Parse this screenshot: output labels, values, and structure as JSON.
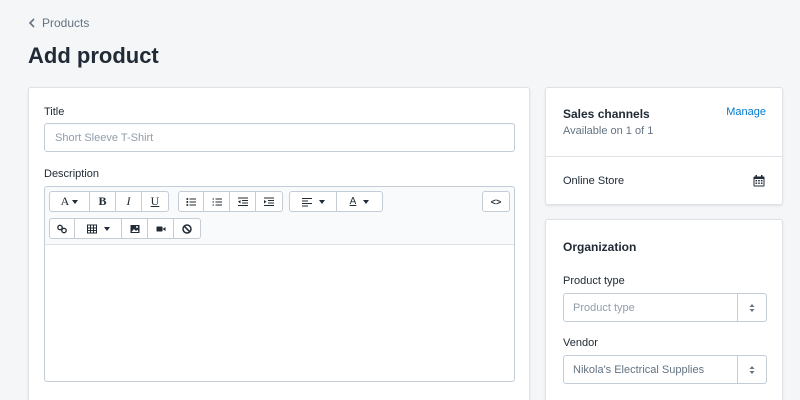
{
  "breadcrumb": {
    "label": "Products"
  },
  "page": {
    "title": "Add product"
  },
  "product": {
    "title_label": "Title",
    "title_placeholder": "Short Sleeve T-Shirt",
    "description_label": "Description",
    "toolbar": {
      "font_label": "A",
      "bold_label": "B",
      "italic_label": "I",
      "underline_label": "U",
      "align_icon": "align-left-icon",
      "color_label": "A",
      "code_label": "<>"
    }
  },
  "sales_channels": {
    "title": "Sales channels",
    "subtitle": "Available on 1 of 1",
    "manage_label": "Manage",
    "channel": "Online Store"
  },
  "organization": {
    "title": "Organization",
    "product_type_label": "Product type",
    "product_type_value": "Product type",
    "vendor_label": "Vendor",
    "vendor_value": "Nikola's Electrical Supplies"
  },
  "colors": {
    "accent": "#007ace",
    "background": "#f4f6f8",
    "border": "#c4cdd5"
  }
}
